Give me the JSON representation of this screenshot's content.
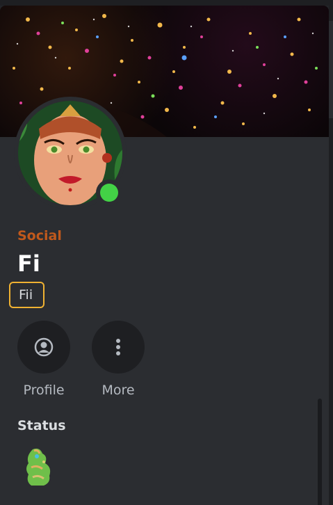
{
  "profile": {
    "server_name": "Social",
    "display_name": "Fi",
    "username": "Fii",
    "online_status_color": "#43d246",
    "accent_color": "#c1591c"
  },
  "actions": [
    {
      "label": "Profile",
      "icon": "user-circle-icon"
    },
    {
      "label": "More",
      "icon": "more-vertical-icon"
    }
  ],
  "status": {
    "title": "Status",
    "emoji_icon": "green-creature-emoji"
  }
}
